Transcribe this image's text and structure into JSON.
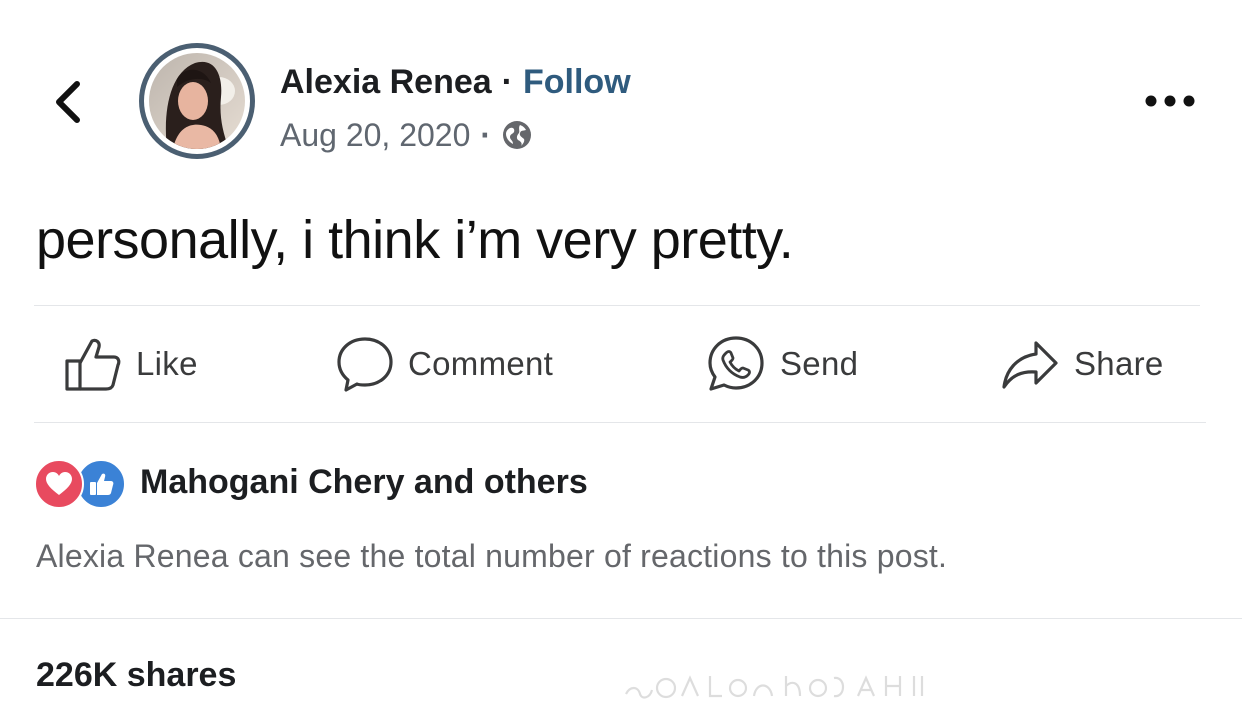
{
  "header": {
    "author_name": "Alexia Renea",
    "separator": "·",
    "follow_label": "Follow",
    "date": "Aug 20, 2020",
    "audience_icon": "globe-icon",
    "back_icon": "chevron-left-icon",
    "more_icon": "more-horizontal-icon"
  },
  "post": {
    "text": "personally, i think i’m very pretty."
  },
  "actions": {
    "like_label": "Like",
    "comment_label": "Comment",
    "send_label": "Send",
    "share_label": "Share"
  },
  "reactions": {
    "icons": [
      "love-reaction-icon",
      "like-reaction-icon"
    ],
    "summary": "Mahogani Chery and others",
    "privacy_note": "Alexia Renea can see the total number of reactions to this post."
  },
  "footer": {
    "shares": "226K shares"
  },
  "colors": {
    "follow": "#2f5b7e",
    "avatar_ring": "#4b5f72",
    "love": "#e84a5f",
    "like": "#3b82d6",
    "secondary_text": "#65676b"
  }
}
